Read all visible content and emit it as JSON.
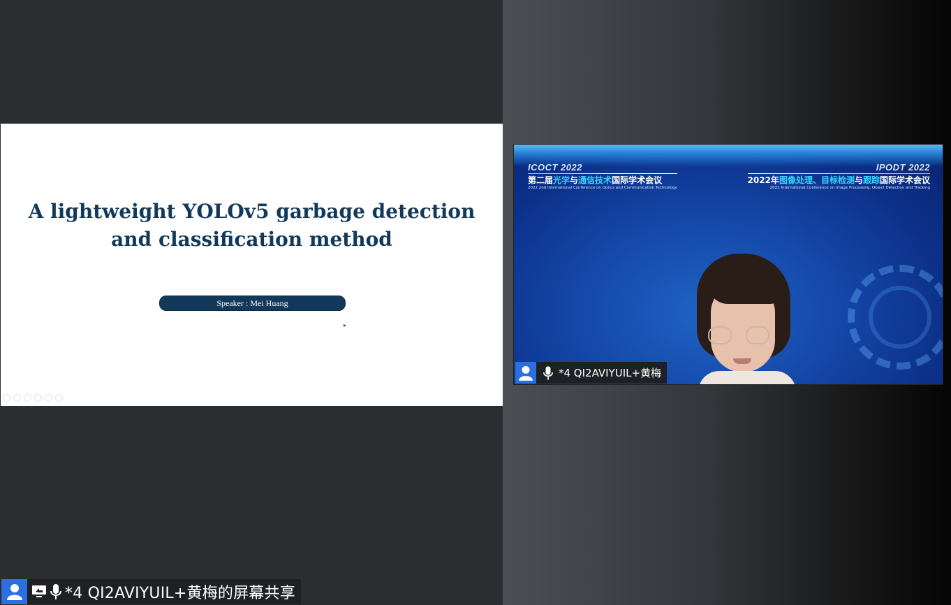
{
  "slide": {
    "title_line1": "A lightweight YOLOv5 garbage detection",
    "title_line2": "and classification method",
    "speaker": "Speaker : Mei Huang"
  },
  "video": {
    "conference_left": {
      "code": "ICOCT 2022",
      "name_part1": "第二届",
      "name_hl1": "光学",
      "name_part2": "与",
      "name_hl2": "通信技术",
      "name_part3": "国际学术会议",
      "subtitle": "2022 2nd International Conference on Optics and Communication Technology"
    },
    "conference_right": {
      "code": "IPODT 2022",
      "name_part1": "2022年",
      "name_hl1": "图像处理、目标检测",
      "name_part2": "与",
      "name_hl2": "跟踪",
      "name_part3": "国际学术会议",
      "subtitle": "2022 International Conference on Image Processing, Object Detection and Tracking"
    },
    "participant_name": "*4 QI2AVIYUIL+黄梅"
  },
  "share": {
    "label": "*4 QI2AVIYUIL+黄梅的屏幕共享"
  },
  "colors": {
    "slide_title": "#13395a",
    "user_badge": "#2b6fe0",
    "highlight": "#36d4ff"
  },
  "icons": [
    "user-icon",
    "microphone-icon",
    "screen-share-icon"
  ]
}
